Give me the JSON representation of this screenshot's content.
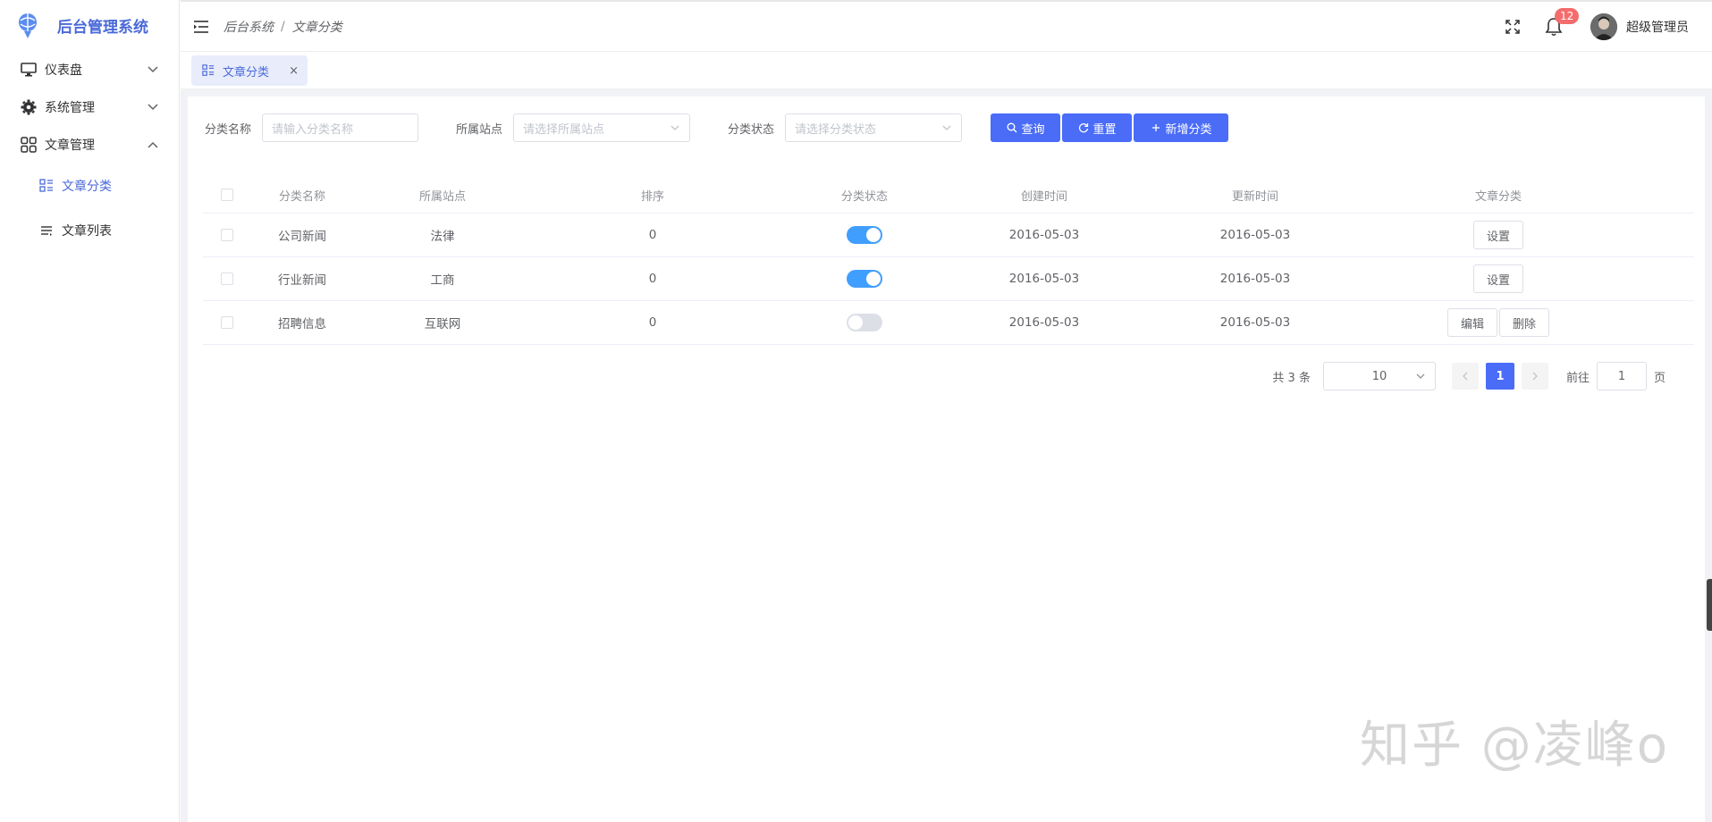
{
  "app": {
    "title": "后台管理系统"
  },
  "sidebar": {
    "items": [
      {
        "label": "仪表盘",
        "icon": "monitor-icon",
        "expanded": false
      },
      {
        "label": "系统管理",
        "icon": "gear-icon",
        "expanded": false
      },
      {
        "label": "文章管理",
        "icon": "grid-icon",
        "expanded": true
      }
    ],
    "sub_items": [
      {
        "label": "文章分类",
        "icon": "category-icon",
        "active": true
      },
      {
        "label": "文章列表",
        "icon": "list-icon",
        "active": false
      }
    ]
  },
  "header": {
    "breadcrumb": [
      "后台系统",
      "文章分类"
    ],
    "breadcrumb_sep": "/",
    "notification_count": "12",
    "username": "超级管理员"
  },
  "tags": [
    {
      "label": "文章分类",
      "close": "×"
    }
  ],
  "filters": {
    "name_label": "分类名称",
    "name_placeholder": "请输入分类名称",
    "site_label": "所属站点",
    "site_placeholder": "请选择所属站点",
    "status_label": "分类状态",
    "status_placeholder": "请选择分类状态",
    "search_button": "查询",
    "reset_button": "重置",
    "add_button": "新增分类"
  },
  "table": {
    "columns": [
      "分类名称",
      "所属站点",
      "排序",
      "分类状态",
      "创建时间",
      "更新时间",
      "文章分类"
    ],
    "rows": [
      {
        "name": "公司新闻",
        "site": "法律",
        "sort": "0",
        "status": true,
        "created": "2016-05-03",
        "updated": "2016-05-03",
        "actions": [
          "设置"
        ]
      },
      {
        "name": "行业新闻",
        "site": "工商",
        "sort": "0",
        "status": true,
        "created": "2016-05-03",
        "updated": "2016-05-03",
        "actions": [
          "设置"
        ]
      },
      {
        "name": "招聘信息",
        "site": "互联网",
        "sort": "0",
        "status": false,
        "created": "2016-05-03",
        "updated": "2016-05-03",
        "actions": [
          "编辑",
          "删除"
        ]
      }
    ]
  },
  "pagination": {
    "total_text": "共 3 条",
    "page_size": "10",
    "current_page": "1",
    "goto_label": "前往",
    "goto_value": "1",
    "page_unit": "页"
  },
  "watermark": "知乎 @凌峰o",
  "colors": {
    "accent": "#4a6cf7",
    "switch_on": "#409eff",
    "badge": "#f56c6c"
  }
}
